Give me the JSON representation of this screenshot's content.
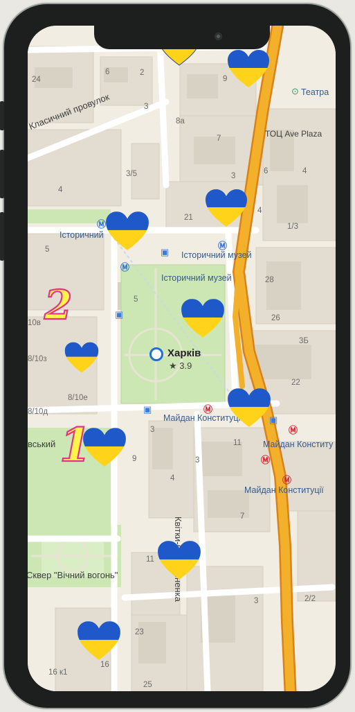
{
  "map": {
    "city": "Харків",
    "rating": "★ 3.9",
    "streets": {
      "klasychnyi": "Класичний провулок",
      "kvitky": "Квітки-Основ'яненка",
      "skver": "Сквер \"Вічний вогонь\"",
      "shevchenkivskyi": "вський"
    },
    "places": {
      "teatr": "Театра",
      "toc": "ТОЦ Ave Plaza",
      "istorychnyi_station": "Історичний",
      "istorychnyi_muzei_1": "Історичний музей",
      "istorychnyi_muzei_2": "Історичний музей",
      "maidan_1": "Майдан Конституції",
      "maidan_2": "Майдан Конститу",
      "maidan_3": "Майдан Конституції"
    },
    "house_numbers": {
      "n6": "6",
      "n2": "2",
      "n24": "24",
      "n9": "9",
      "n3a": "3",
      "n8a": "8а",
      "n7": "7",
      "n6b": "6",
      "n4a": "4",
      "n3_5": "3/5",
      "n4b": "4",
      "n3b": "3",
      "n21": "21",
      "n4c": "4",
      "n1_3": "1/3",
      "n5a": "5",
      "n5b": "5",
      "n28": "28",
      "n26": "26",
      "n10v": "10в",
      "n8_10z": "8/10з",
      "n35": "3Б",
      "n22": "22",
      "n8_10e": "8/10е",
      "n8_10d": "8/10д",
      "n3c": "3",
      "n9b": "9",
      "n3d": "3",
      "n11": "11",
      "n4d": "4",
      "n7b": "7",
      "n11b": "11",
      "n3e": "3",
      "n2_2": "2/2",
      "n23": "23",
      "n16": "16",
      "n16k": "16 к1",
      "n25": "25"
    },
    "icons": [
      "metro-icon",
      "bus-stop-icon",
      "city-pin-icon",
      "heart-icon"
    ]
  },
  "badges": {
    "one": "1",
    "two": "2"
  },
  "colors": {
    "highway": "#e8a020",
    "park": "#cde7b4",
    "heart_top": "#1e58c9",
    "heart_bottom": "#ffd31a",
    "badge_fill": "#fff44a",
    "badge_stroke": "#e2338a"
  }
}
